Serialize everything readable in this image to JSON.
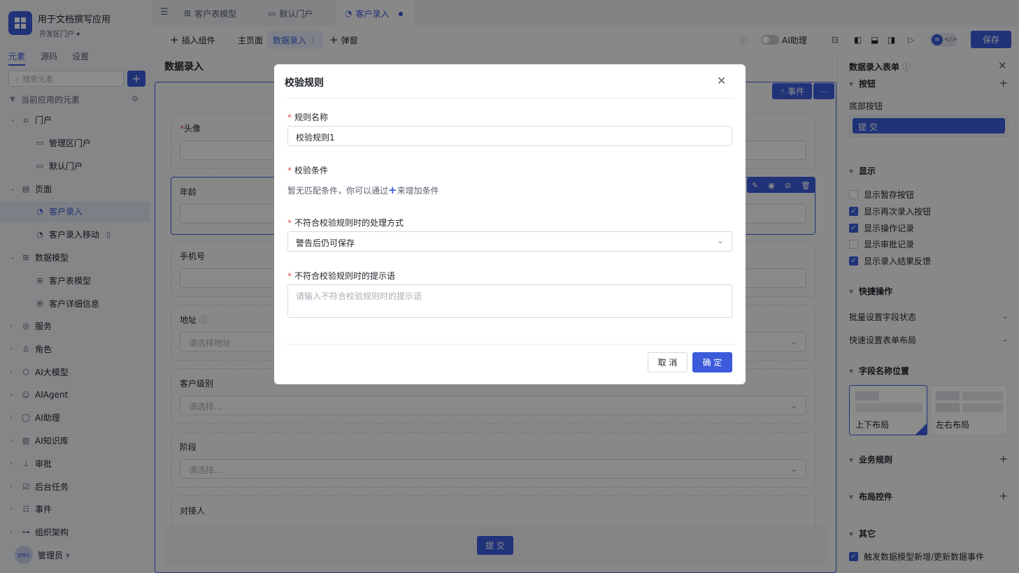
{
  "app": {
    "name": "用于文档撰写应用",
    "portal": "开发区门户"
  },
  "sidebar_tabs": [
    "元素",
    "源码",
    "设置"
  ],
  "search_placeholder": "搜索元素",
  "tree": {
    "root": "当前应用的元素",
    "items": [
      {
        "label": "门户"
      },
      {
        "label": "管理区门户"
      },
      {
        "label": "默认门户"
      },
      {
        "label": "页面"
      },
      {
        "label": "客户录入"
      },
      {
        "label": "客户录入移动"
      },
      {
        "label": "数据模型"
      },
      {
        "label": "客户表模型"
      },
      {
        "label": "客户详细信息"
      },
      {
        "label": "服务"
      },
      {
        "label": "角色"
      },
      {
        "label": "AI大模型"
      },
      {
        "label": "AIAgent"
      },
      {
        "label": "AI助理"
      },
      {
        "label": "AI知识库"
      },
      {
        "label": "审批"
      },
      {
        "label": "后台任务"
      },
      {
        "label": "事件"
      },
      {
        "label": "组织架构"
      }
    ]
  },
  "user": {
    "name": "管理员",
    "avatar_text": "管理员"
  },
  "tabs": [
    "客户表模型",
    "默认门户",
    "客户录入"
  ],
  "toolbar": {
    "insert": "插入组件",
    "home": "主页面",
    "data_entry": "数据录入",
    "popup": "弹窗",
    "ai": "AI助理",
    "save": "保存"
  },
  "page": {
    "title": "数据录入",
    "event": "事件",
    "submit": "提 交"
  },
  "fields": [
    {
      "label": "头像",
      "required": true,
      "placeholder": ""
    },
    {
      "label": "年龄",
      "required": false,
      "placeholder": ""
    },
    {
      "label": "手机号",
      "required": false,
      "placeholder": ""
    },
    {
      "label": "地址",
      "required": false,
      "placeholder": "请选择地址"
    },
    {
      "label": "客户级别",
      "required": false,
      "placeholder": "请选择..."
    },
    {
      "label": "阶段",
      "required": false,
      "placeholder": "请选择..."
    },
    {
      "label": "对接人",
      "required": false,
      "placeholder": ""
    }
  ],
  "panel": {
    "title": "数据录入表单",
    "buttons_section": "按钮",
    "bottom_buttons": "底部按钮",
    "submit": "提 交",
    "display_section": "显示",
    "display_options": [
      {
        "label": "显示暂存按钮",
        "checked": false
      },
      {
        "label": "显示再次录入按钮",
        "checked": true
      },
      {
        "label": "显示操作记录",
        "checked": true
      },
      {
        "label": "显示审批记录",
        "checked": false
      },
      {
        "label": "显示录入结果反馈",
        "checked": true
      }
    ],
    "quick_section": "快捷操作",
    "quick_items": [
      "批量设置字段状态",
      "快速设置表单布局"
    ],
    "label_pos_section": "字段名称位置",
    "layout_top": "上下布局",
    "layout_left": "左右布局",
    "business_rules": "业务规则",
    "layout_controls": "布局控件",
    "other": "其它",
    "trigger": "触发数据模型新增/更新数据事件"
  },
  "modal": {
    "title": "校验规则",
    "rule_name_label": "规则名称",
    "rule_name_value": "校验规则1",
    "condition_label": "校验条件",
    "condition_hint_a": "暂无匹配条件，你可以通过",
    "condition_hint_b": "来增加条件",
    "handling_label": "不符合校验规则时的处理方式",
    "handling_value": "警告后仍可保存",
    "tip_label": "不符合校验规则时的提示语",
    "tip_placeholder": "请输入不符合校验规则时的提示语",
    "cancel": "取 消",
    "ok": "确 定"
  },
  "colors": {
    "primary": "#3b5bdb",
    "required": "#e34d59"
  }
}
